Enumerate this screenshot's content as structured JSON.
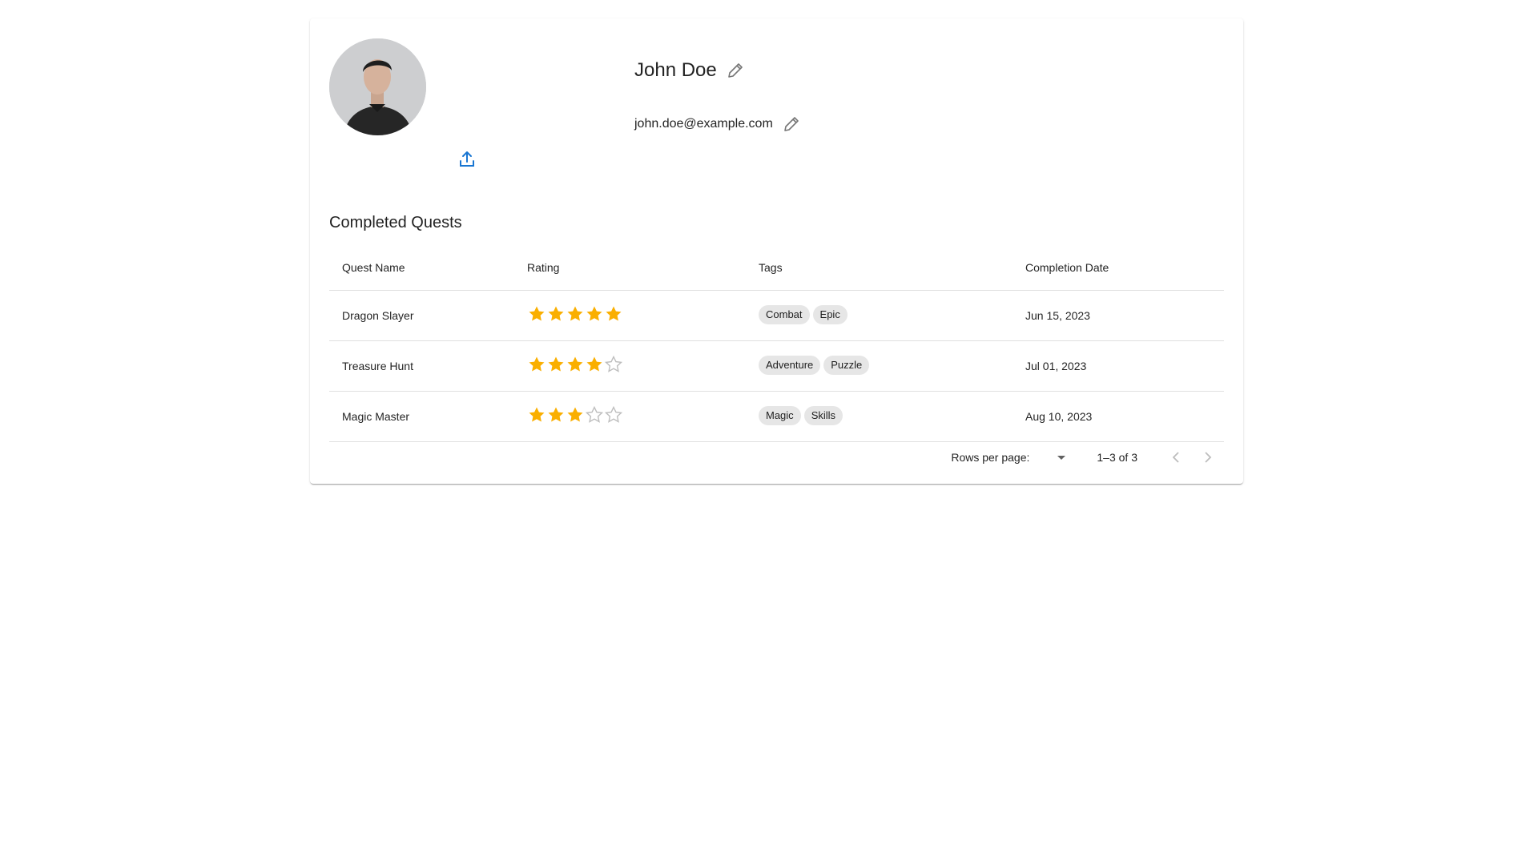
{
  "profile": {
    "name": "John Doe",
    "email": "john.doe@example.com",
    "avatar_alt": "avatar"
  },
  "icons": {
    "upload": "upload-icon",
    "edit": "pencil-icon",
    "star_filled": "star-icon",
    "star_empty": "star-outline-icon",
    "dropdown": "arrow-drop-down-icon",
    "prev": "chevron-left-icon",
    "next": "chevron-right-icon"
  },
  "colors": {
    "star": "#faaf00",
    "star_empty": "#bdbdbd",
    "upload": "#1976d2",
    "chip_bg": "#e6e6e6"
  },
  "quests": {
    "title": "Completed Quests",
    "columns": [
      "Quest Name",
      "Rating",
      "Tags",
      "Completion Date"
    ],
    "rows": [
      {
        "name": "Dragon Slayer",
        "rating": 5,
        "tags": [
          "Combat",
          "Epic"
        ],
        "date": "Jun 15, 2023"
      },
      {
        "name": "Treasure Hunt",
        "rating": 4,
        "tags": [
          "Adventure",
          "Puzzle"
        ],
        "date": "Jul 01, 2023"
      },
      {
        "name": "Magic Master",
        "rating": 3,
        "tags": [
          "Magic",
          "Skills"
        ],
        "date": "Aug 10, 2023"
      }
    ],
    "max_rating": 5
  },
  "pagination": {
    "rows_label": "Rows per page:",
    "rows_value": "",
    "range": "1–3 of 3"
  }
}
